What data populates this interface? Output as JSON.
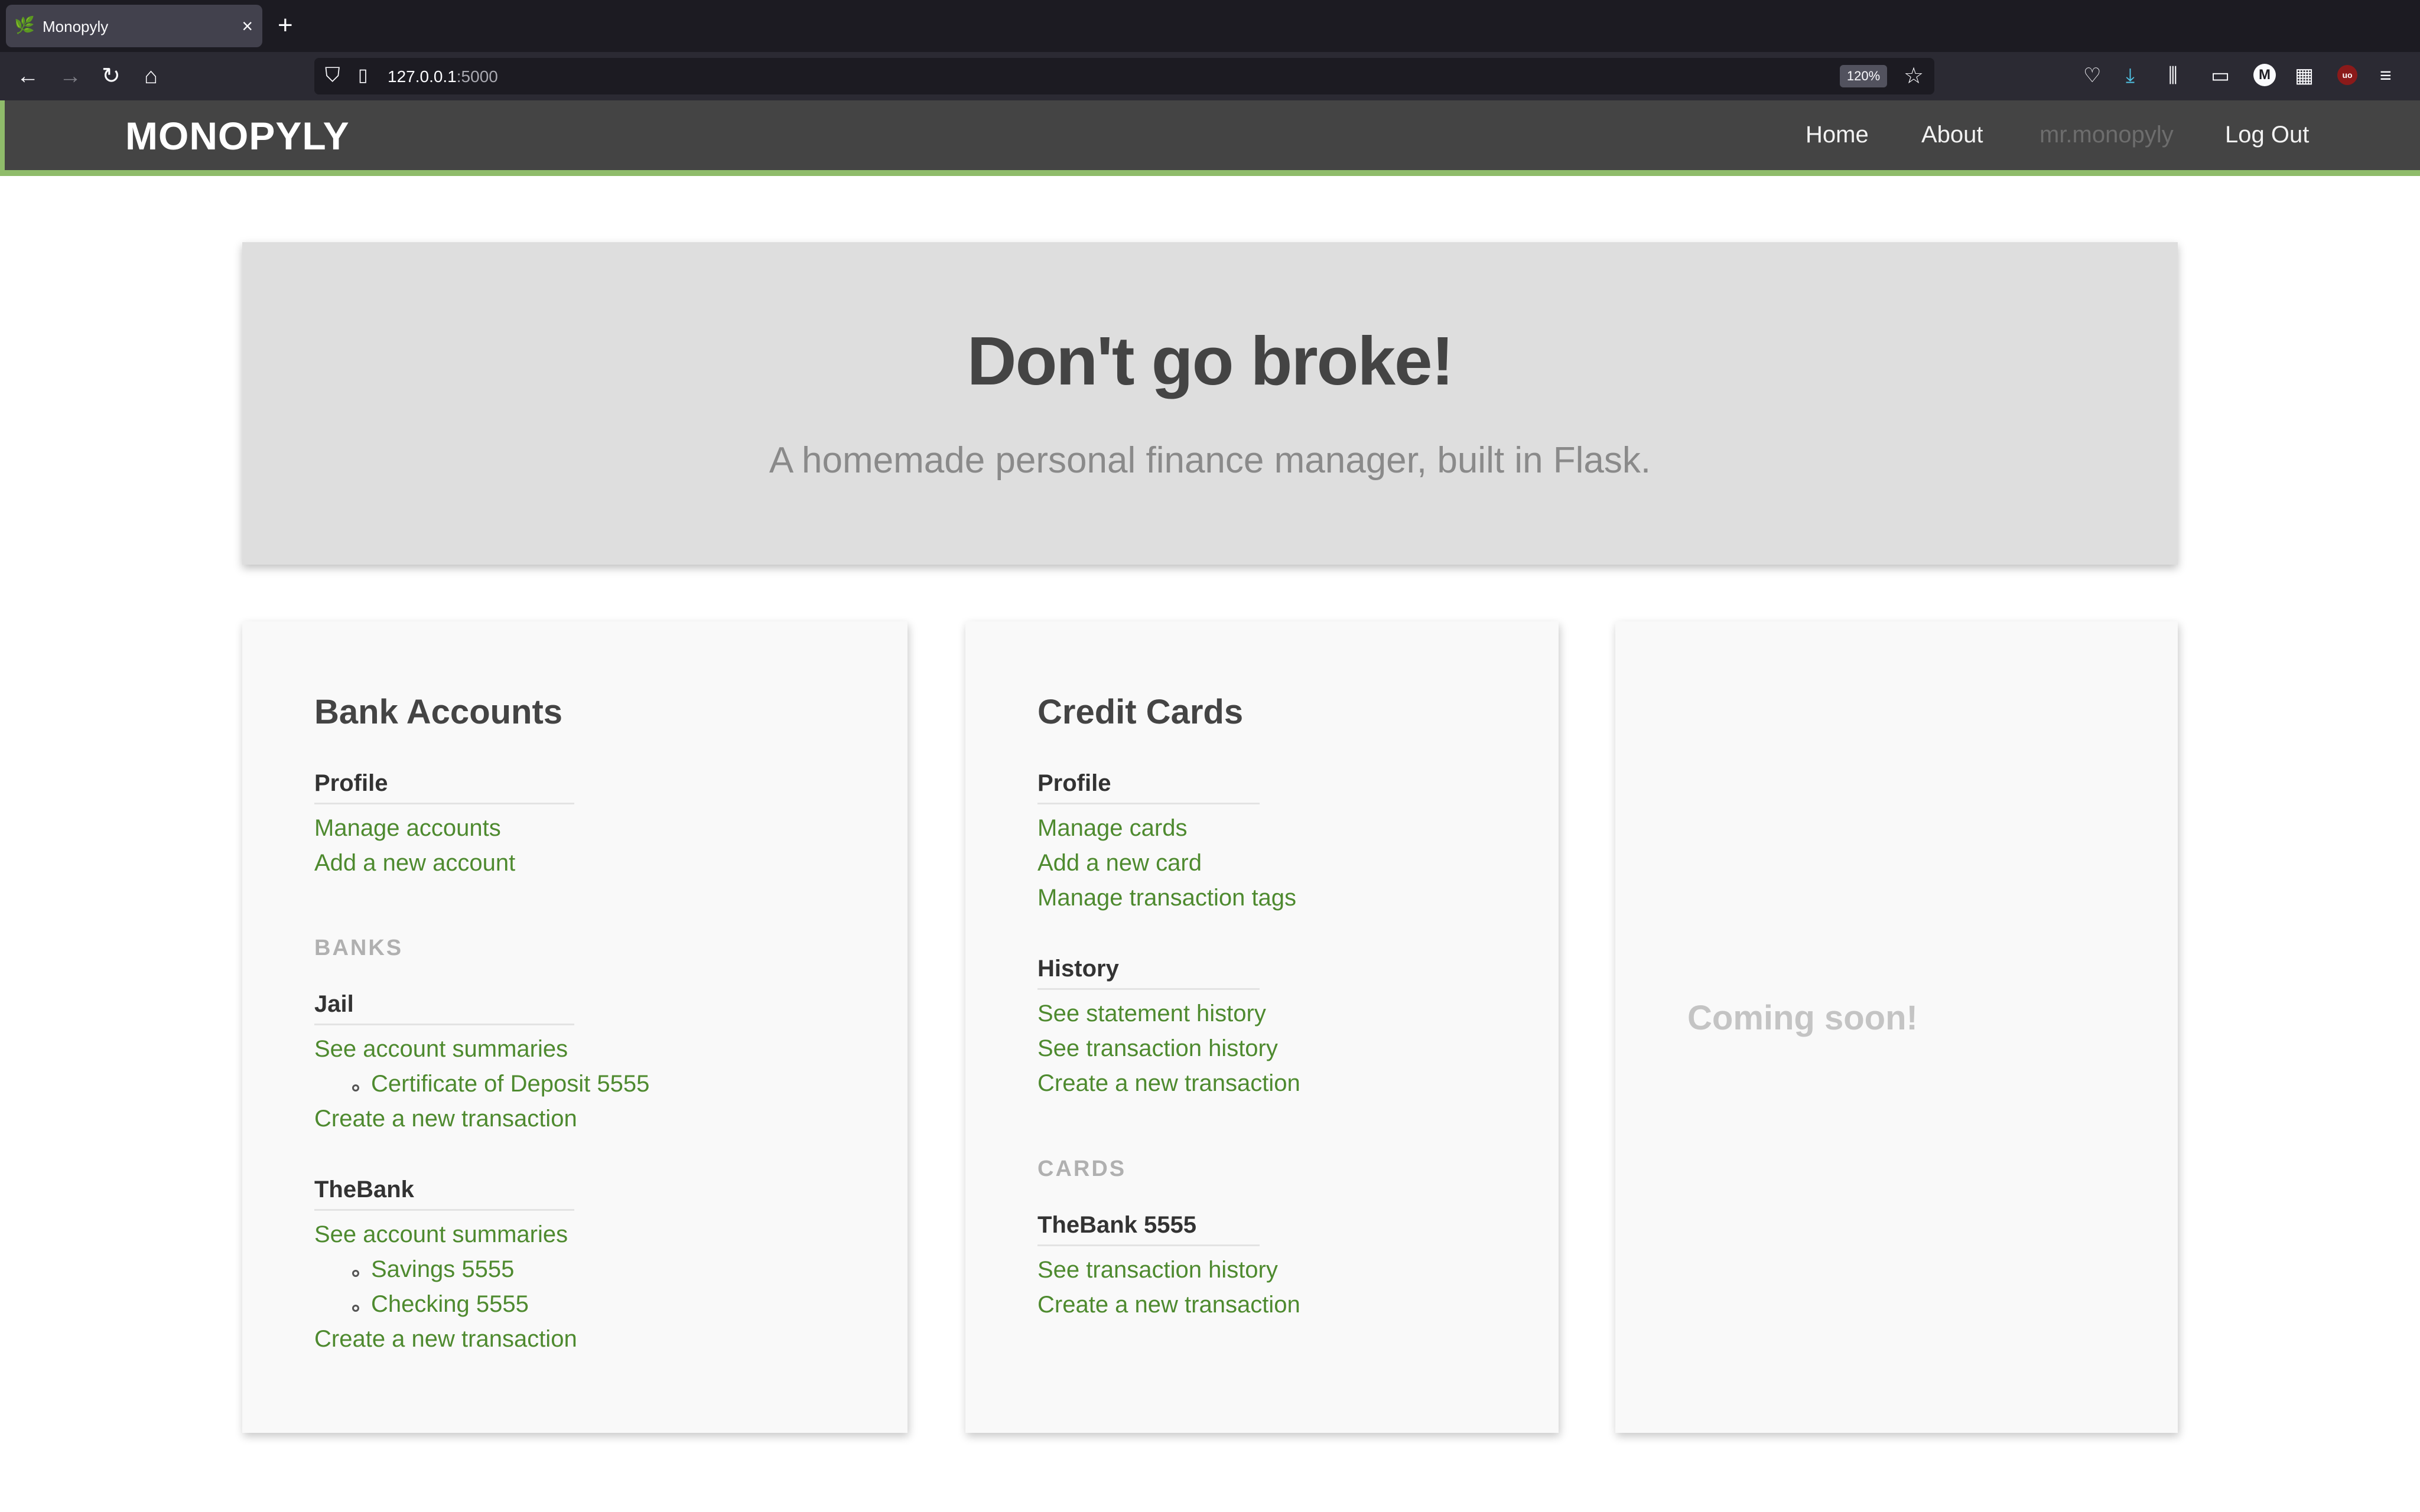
{
  "browser": {
    "tab_title": "Monopyly",
    "tab_favicon": "🌿",
    "url_host": "127.0.0.1",
    "url_port": ":5000",
    "zoom": "120%",
    "icons": {
      "back": "←",
      "forward": "→",
      "reload": "↻",
      "home": "⌂",
      "shield": "⛉",
      "page": "▯",
      "star": "☆",
      "pocket": "♡",
      "download": "⤓",
      "library": "⫼",
      "sidebar": "▭",
      "account": "M",
      "extensions": "▦",
      "ublock": "uo",
      "menu": "≡",
      "close": "×",
      "new_tab": "+"
    }
  },
  "site": {
    "brand": "MONOPYLY",
    "nav": [
      "Home",
      "About",
      "mr.monopyly",
      "Log Out"
    ]
  },
  "hero": {
    "title": "Don't go broke!",
    "subtitle": "A homemade personal finance manager, built in Flask."
  },
  "bank": {
    "title": "Bank Accounts",
    "profile_heading": "Profile",
    "profile_links": [
      "Manage accounts",
      "Add a new account"
    ],
    "banks_label": "BANKS",
    "banks": [
      {
        "name": "Jail",
        "summaries": "See account summaries",
        "accounts": [
          "Certificate of Deposit 5555"
        ],
        "create": "Create a new transaction"
      },
      {
        "name": "TheBank",
        "summaries": "See account summaries",
        "accounts": [
          "Savings 5555",
          "Checking 5555"
        ],
        "create": "Create a new transaction"
      }
    ]
  },
  "credit": {
    "title": "Credit Cards",
    "profile_heading": "Profile",
    "profile_links": [
      "Manage cards",
      "Add a new card",
      "Manage transaction tags"
    ],
    "history_heading": "History",
    "history_links": [
      "See statement history",
      "See transaction history",
      "Create a new transaction"
    ],
    "cards_label": "CARDS",
    "cards": [
      {
        "name": "TheBank 5555",
        "links": [
          "See transaction history",
          "Create a new transaction"
        ]
      }
    ]
  },
  "coming": {
    "text": "Coming soon!"
  }
}
